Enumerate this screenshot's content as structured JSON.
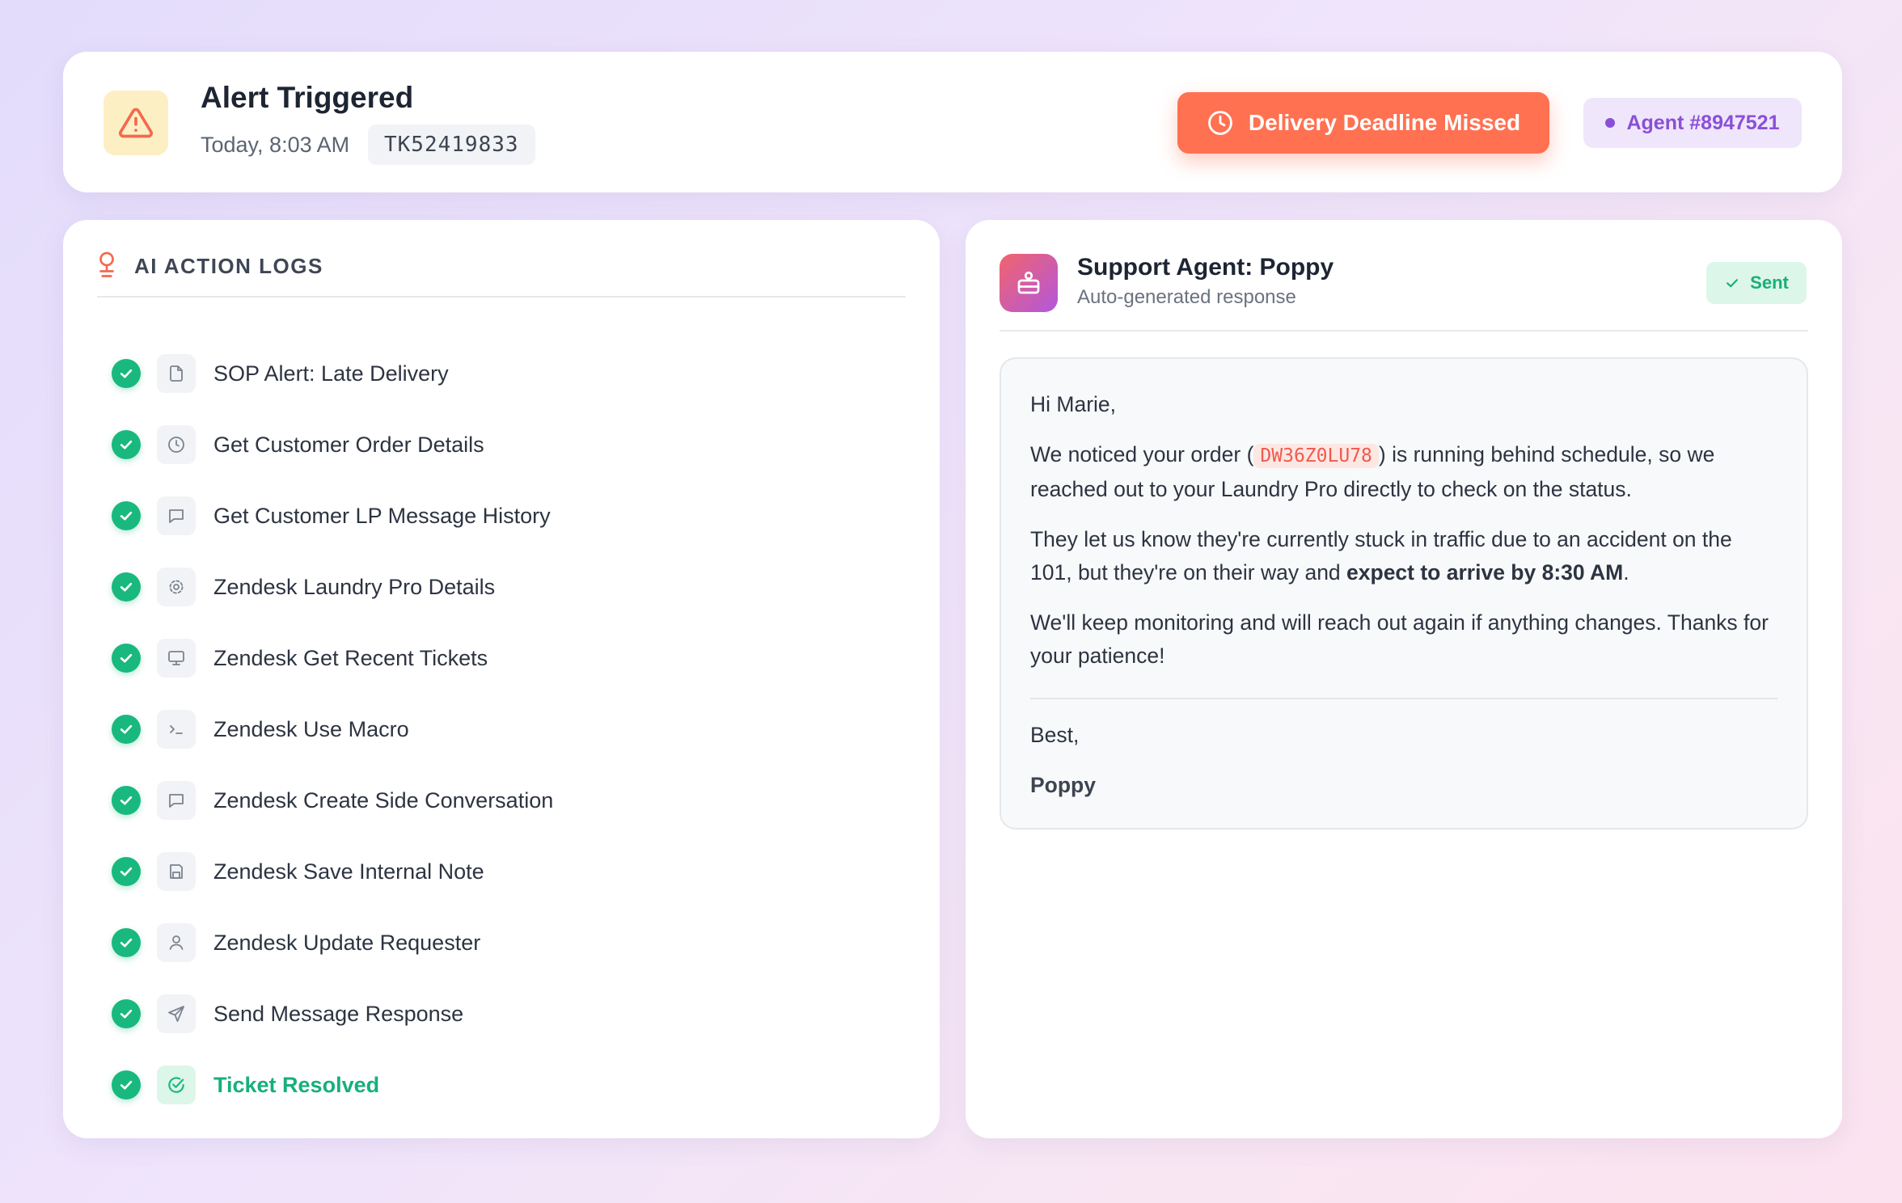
{
  "header": {
    "title": "Alert Triggered",
    "time": "Today, 8:03 AM",
    "ticket_id": "TK52419833",
    "deadline_button": "Delivery Deadline Missed",
    "agent_chip": "Agent #8947521",
    "icons": {
      "alert": "warning-triangle-icon",
      "deadline": "clock-icon"
    },
    "colors": {
      "alert_bg": "#fdefc4",
      "alert_icon": "#f26a4f",
      "deadline_bg": "#ff7151",
      "agent_text": "#8a4fd8",
      "agent_bg": "#efe6fb"
    }
  },
  "logs": {
    "title": "AI ACTION LOGS",
    "header_icon": "lightbulb-icon",
    "items": [
      {
        "label": "SOP Alert: Late Delivery",
        "icon": "document-icon",
        "status": "done"
      },
      {
        "label": "Get Customer Order Details",
        "icon": "clock-icon",
        "status": "done"
      },
      {
        "label": "Get Customer LP Message History",
        "icon": "message-icon",
        "status": "done"
      },
      {
        "label": "Zendesk Laundry Pro Details",
        "icon": "gear-icon",
        "status": "done"
      },
      {
        "label": "Zendesk Get Recent Tickets",
        "icon": "monitor-icon",
        "status": "done"
      },
      {
        "label": "Zendesk Use Macro",
        "icon": "terminal-icon",
        "status": "done"
      },
      {
        "label": "Zendesk Create Side Conversation",
        "icon": "message-icon",
        "status": "done"
      },
      {
        "label": "Zendesk Save Internal Note",
        "icon": "save-icon",
        "status": "done"
      },
      {
        "label": "Zendesk Update Requester",
        "icon": "user-icon",
        "status": "done"
      },
      {
        "label": "Send Message Response",
        "icon": "send-icon",
        "status": "done"
      },
      {
        "label": "Ticket Resolved",
        "icon": "check-circle-icon",
        "status": "resolved"
      }
    ],
    "colors": {
      "success": "#19b87f"
    }
  },
  "response": {
    "agent_name": "Support Agent: Poppy",
    "subtitle": "Auto-generated response",
    "status": "Sent",
    "avatar_icon": "robot-icon",
    "message": {
      "greeting": "Hi Marie,",
      "p1_before": "We noticed your order (",
      "order_code": "DW36Z0LU78",
      "p1_after": ") is running behind schedule, so we reached out to your Laundry Pro directly to check on the status.",
      "p2_before": "They let us know they're currently stuck in traffic due to an accident on the 101, but they're on their way and ",
      "p2_bold": "expect to arrive by 8:30 AM",
      "p2_after": ".",
      "p3": "We'll keep monitoring and will reach out again if anything changes. Thanks for your patience!",
      "signoff": "Best,",
      "signature": "Poppy"
    }
  }
}
